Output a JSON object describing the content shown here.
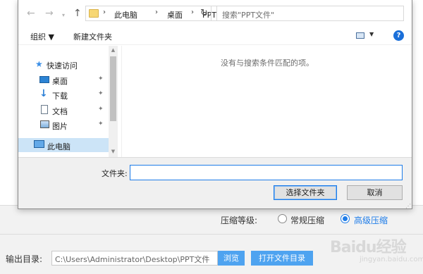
{
  "dialog": {
    "nav": {
      "back": "←",
      "forward": "→",
      "up": "↑",
      "dropdown": "▾"
    },
    "address": {
      "crumbs": [
        "此电脑",
        "桌面",
        "PPT文件"
      ],
      "chevron": "›",
      "dropdown": "▾",
      "refresh": "↻"
    },
    "search_placeholder": "搜索\"PPT文件\"",
    "toolbar": {
      "organize": "组织 ▼",
      "new_folder": "新建文件夹",
      "view_dropdown": "▼",
      "help": "?"
    },
    "nav_pane": {
      "items": [
        {
          "label": "快速访问",
          "pinned": false
        },
        {
          "label": "桌面",
          "pinned": true
        },
        {
          "label": "下载",
          "pinned": true
        },
        {
          "label": "文档",
          "pinned": true
        },
        {
          "label": "图片",
          "pinned": true
        },
        {
          "label": "此电脑",
          "pinned": false,
          "selected": true
        }
      ],
      "pin_glyph": "📌",
      "scroll_up": "▲",
      "scroll_down": "▼"
    },
    "empty_message": "没有与搜索条件匹配的项。",
    "folder_label": "文件夹:",
    "folder_value": "",
    "buttons": {
      "select": "选择文件夹",
      "cancel": "取消"
    },
    "grip": "⋰"
  },
  "app": {
    "compress_label": "压缩等级:",
    "options": [
      {
        "label": "常规压缩",
        "checked": false
      },
      {
        "label": "高级压缩",
        "checked": true
      }
    ],
    "output_label": "输出目录:",
    "output_path": "C:\\Users\\Administrator\\Desktop\\PPT文件",
    "browse": "浏览",
    "open_folder": "打开文件目录"
  },
  "watermark": {
    "main": "Baidu经验",
    "sub": "jingyan.baidu.com"
  },
  "colors": {
    "accent": "#1e7ce8",
    "button_blue": "#4ea3f0",
    "selected": "#cce4f7"
  }
}
